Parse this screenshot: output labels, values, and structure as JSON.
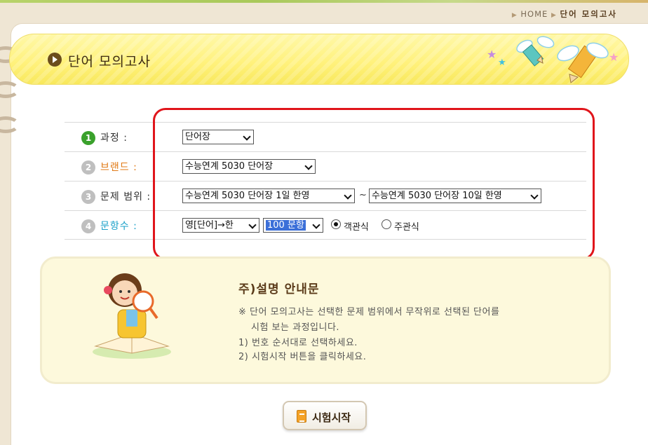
{
  "breadcrumb": {
    "home": "HOME",
    "current": "단어 모의고사"
  },
  "page_title": "단어 모의고사",
  "form": {
    "course": {
      "num": "1",
      "label": "과정 :",
      "value": "단어장"
    },
    "brand": {
      "num": "2",
      "label": "브랜드 :",
      "value": "수능연계 5030 단어장"
    },
    "range": {
      "num": "3",
      "label": "문제 범위 :",
      "from": "수능연계 5030 단어장 1일 한영",
      "sep": "~",
      "to": "수능연계 5030 단어장 10일 한영"
    },
    "count": {
      "num": "4",
      "label": "문항수 :",
      "direction": "영[단어]→한",
      "questions": "100 문항",
      "objective": "객관식",
      "subjective": "주관식"
    }
  },
  "info": {
    "title": "주)설명 안내문",
    "line1": "※ 단어 모의고사는 선택한 문제 범위에서 무작위로 선택된 단어를",
    "line2": "시험 보는 과정입니다.",
    "line3": "1) 번호 순서대로 선택하세요.",
    "line4": "2) 시험시작 버튼을 클릭하세요."
  },
  "start_button": "시험시작",
  "colors": {
    "step1": "#3aa12c",
    "step_inactive": "#bfbfbf",
    "brand_label": "#e07a16",
    "count_label": "#1aa0c8",
    "highlight": "#e0151b"
  }
}
